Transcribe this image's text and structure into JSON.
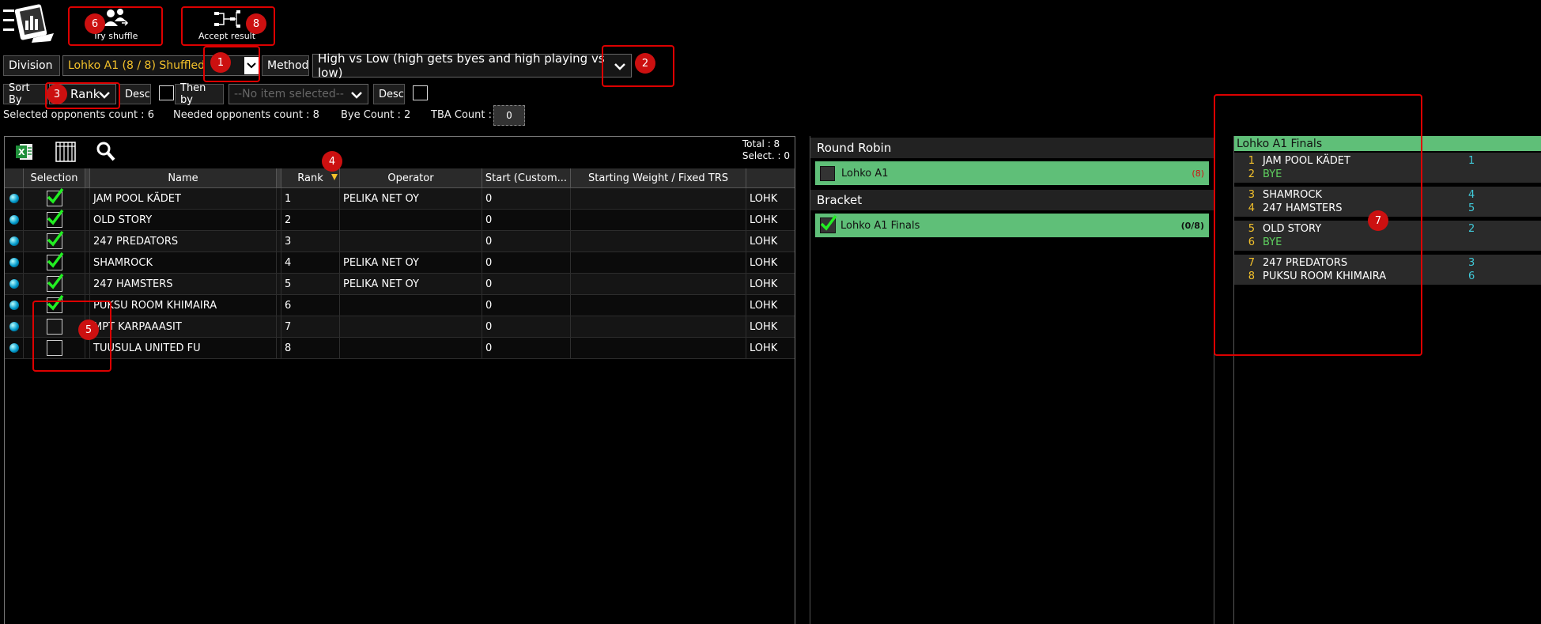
{
  "toolbar": {
    "try_shuffle_label": "Try shuffle",
    "accept_result_label": "Accept result"
  },
  "filters": {
    "division_label": "Division",
    "division_value": "Lohko A1 (8 / 8) Shuffled",
    "method_label": "Method",
    "method_value": "High vs Low (high gets byes and high playing vs low)",
    "sort_by_label": "Sort By",
    "sort_by_value": "Rank",
    "desc_label": "Desc",
    "then_by_label": "Then by",
    "then_by_placeholder": "--No item selected--",
    "desc2_label": "Desc"
  },
  "counts": {
    "selected_opponents": "Selected opponents count : 6",
    "needed_opponents": "Needed opponents count : 8",
    "bye_count": "Bye Count : 2",
    "tba_count_label": "TBA Count :",
    "tba_count_value": "0"
  },
  "grid": {
    "total": "Total : 8",
    "select": "Select. : 0",
    "columns": [
      "Selection",
      "Name",
      "Rank",
      "Operator",
      "Start (Custom...",
      "Starting Weight / Fixed TRS"
    ],
    "rows": [
      {
        "selected": true,
        "name": "JAM POOL KÄDET",
        "rank": "1",
        "operator": "PELIKA NET OY",
        "start": "0",
        "extra": "LOHK"
      },
      {
        "selected": true,
        "name": "OLD STORY",
        "rank": "2",
        "operator": "",
        "start": "0",
        "extra": "LOHK"
      },
      {
        "selected": true,
        "name": "247 PREDATORS",
        "rank": "3",
        "operator": "",
        "start": "0",
        "extra": "LOHK"
      },
      {
        "selected": true,
        "name": "SHAMROCK",
        "rank": "4",
        "operator": "PELIKA NET OY",
        "start": "0",
        "extra": "LOHK"
      },
      {
        "selected": true,
        "name": "247 HAMSTERS",
        "rank": "5",
        "operator": "PELIKA NET OY",
        "start": "0",
        "extra": "LOHK"
      },
      {
        "selected": true,
        "name": "PUKSU ROOM KHIMAIRA",
        "rank": "6",
        "operator": "",
        "start": "0",
        "extra": "LOHK"
      },
      {
        "selected": false,
        "name": "MPT KARPAAASIT",
        "rank": "7",
        "operator": "",
        "start": "0",
        "extra": "LOHK"
      },
      {
        "selected": false,
        "name": "TUUSULA UNITED FU",
        "rank": "8",
        "operator": "",
        "start": "0",
        "extra": "LOHK"
      }
    ]
  },
  "middle": {
    "round_robin_title": "Round Robin",
    "round_robin_item": "Lohko A1",
    "round_robin_count": "(8)",
    "bracket_title": "Bracket",
    "bracket_item": "Lohko A1 Finals",
    "bracket_count": "(0/8)"
  },
  "bracket": {
    "title": "Lohko A1 Finals",
    "matches": [
      [
        {
          "seed": "1",
          "name": "JAM POOL KÄDET",
          "rank": "1"
        },
        {
          "seed": "2",
          "name": "BYE",
          "rank": ""
        }
      ],
      [
        {
          "seed": "3",
          "name": "SHAMROCK",
          "rank": "4"
        },
        {
          "seed": "4",
          "name": "247 HAMSTERS",
          "rank": "5"
        }
      ],
      [
        {
          "seed": "5",
          "name": "OLD STORY",
          "rank": "2"
        },
        {
          "seed": "6",
          "name": "BYE",
          "rank": ""
        }
      ],
      [
        {
          "seed": "7",
          "name": "247 PREDATORS",
          "rank": "3"
        },
        {
          "seed": "8",
          "name": "PUKSU ROOM KHIMAIRA",
          "rank": "6"
        }
      ]
    ]
  },
  "callouts": [
    "1",
    "2",
    "3",
    "4",
    "5",
    "6",
    "7",
    "8"
  ],
  "colors": {
    "accent_green": "#5fbf78",
    "seed_yellow": "#f3c12b",
    "rank_cyan": "#40c9d8",
    "callout_red": "#cc1010"
  }
}
